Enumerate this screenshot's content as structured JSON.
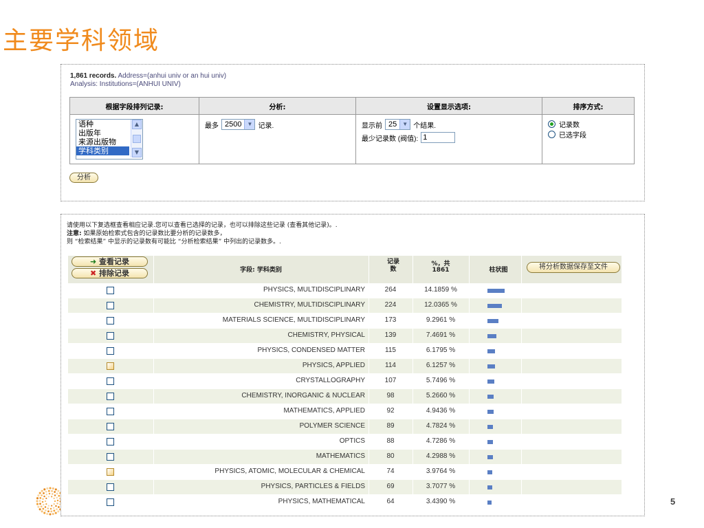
{
  "slide": {
    "title": "主要学科领域",
    "page_number": "5"
  },
  "summary": {
    "records": "1,861 records.",
    "address": "Address=(anhui univ or an hui univ)",
    "analysis": "Analysis:  Institutions=(ANHUI UNIV)"
  },
  "options": {
    "headers": [
      "根据字段排列记录:",
      "分析:",
      "设置显示选项:",
      "排序方式:"
    ],
    "field_list": {
      "items": [
        "语种",
        "出版年",
        "来源出版物",
        "学科类别"
      ],
      "selected": "学科类别"
    },
    "analyze": {
      "prefix": "最多",
      "value": "2500",
      "suffix": "记录."
    },
    "display": {
      "prefix": "显示前",
      "value": "25",
      "suffix": "个结果.",
      "min_label": "最少记录数 (阀值):",
      "min_value": "1"
    },
    "sort": {
      "options": [
        "记录数",
        "已选字段"
      ],
      "selected": "记录数"
    },
    "analyze_button": "分析"
  },
  "notes": {
    "line1": "请使用以下复选框查看相应记录.您可以查看已选择的记录，也可以排除这些记录 (查看其他记录)。.",
    "line2_bold": "注意:",
    "line2_rest": " 如果原始检索式包含的记录数比要分析的记录数多，",
    "line3": "则 “检索结果” 中显示的记录数有可能比 “分析检索结果” 中列出的记录数多。."
  },
  "results": {
    "view_button": "查看记录",
    "exclude_button": "排除记录",
    "columns": {
      "field": "字段: 学科类别",
      "count": "记录数",
      "percent_l1": "%，共",
      "percent_l2": "1861",
      "bar": "柱状图"
    },
    "save_button": "将分析数据保存至文件",
    "rows": [
      {
        "label": "PHYSICS, MULTIDISCIPLINARY",
        "count": 264,
        "count_text": "264",
        "percent": "14.1859 %",
        "checkbox": "plain"
      },
      {
        "label": "CHEMISTRY, MULTIDISCIPLINARY",
        "count": 224,
        "count_text": "224",
        "percent": "12.0365 %",
        "checkbox": "plain"
      },
      {
        "label": "MATERIALS SCIENCE, MULTIDISCIPLINARY",
        "count": 173,
        "count_text": "173",
        "percent": "9.2961 %",
        "checkbox": "plain"
      },
      {
        "label": "CHEMISTRY, PHYSICAL",
        "count": 139,
        "count_text": "139",
        "percent": "7.4691 %",
        "checkbox": "plain"
      },
      {
        "label": "PHYSICS, CONDENSED MATTER",
        "count": 115,
        "count_text": "115",
        "percent": "6.1795 %",
        "checkbox": "plain"
      },
      {
        "label": "PHYSICS, APPLIED",
        "count": 114,
        "count_text": "114",
        "percent": "6.1257 %",
        "checkbox": "shaded"
      },
      {
        "label": "CRYSTALLOGRAPHY",
        "count": 107,
        "count_text": "107",
        "percent": "5.7496 %",
        "checkbox": "plain"
      },
      {
        "label": "CHEMISTRY, INORGANIC & NUCLEAR",
        "count": 98,
        "count_text": "98",
        "percent": "5.2660 %",
        "checkbox": "plain"
      },
      {
        "label": "MATHEMATICS, APPLIED",
        "count": 92,
        "count_text": "92",
        "percent": "4.9436 %",
        "checkbox": "plain"
      },
      {
        "label": "POLYMER SCIENCE",
        "count": 89,
        "count_text": "89",
        "percent": "4.7824 %",
        "checkbox": "plain"
      },
      {
        "label": "OPTICS",
        "count": 88,
        "count_text": "88",
        "percent": "4.7286 %",
        "checkbox": "plain"
      },
      {
        "label": "MATHEMATICS",
        "count": 80,
        "count_text": "80",
        "percent": "4.2988 %",
        "checkbox": "plain"
      },
      {
        "label": "PHYSICS, ATOMIC, MOLECULAR & CHEMICAL",
        "count": 74,
        "count_text": "74",
        "percent": "3.9764 %",
        "checkbox": "shaded"
      },
      {
        "label": "PHYSICS, PARTICLES & FIELDS",
        "count": 69,
        "count_text": "69",
        "percent": "3.7077 %",
        "checkbox": "plain"
      },
      {
        "label": "PHYSICS, MATHEMATICAL",
        "count": 64,
        "count_text": "64",
        "percent": "3.4390 %",
        "checkbox": "plain"
      }
    ]
  },
  "colors": {
    "title": "#f08a1c",
    "bar": "#5a7fc4",
    "alt_row": "#eef1e4",
    "selected": "#316ac5"
  },
  "icons": {
    "logo": "publisher-logo",
    "check_view": "arrow-right-icon",
    "check_exclude": "x-icon"
  }
}
